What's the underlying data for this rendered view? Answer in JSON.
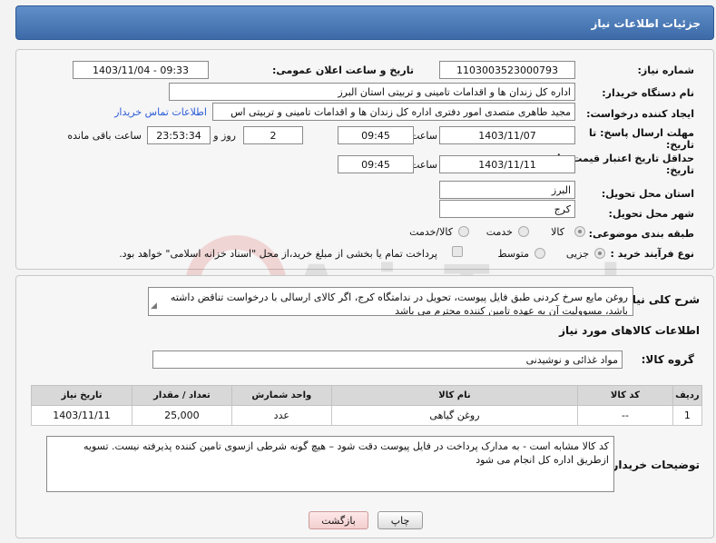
{
  "header": {
    "title": "جزئیات اطلاعات نیاز"
  },
  "form": {
    "need_number_label": "شماره نیاز:",
    "need_number": "1103003523000793",
    "announce_label": "تاریخ و ساعت اعلان عمومی:",
    "announce_value": "1403/11/04 - 09:33",
    "buyer_org_label": "نام دستگاه خریدار:",
    "buyer_org": "اداره کل زندان ها و اقدامات تامینی و تربیتی استان البرز",
    "requester_label": "ایجاد کننده درخواست:",
    "requester": "مجید طاهری متصدی امور دفتری اداره کل زندان ها و اقدامات تامینی و تربیتی اس",
    "contact_link": "اطلاعات تماس خریدار",
    "reply_deadline_label": "مهلت ارسال پاسخ: تا",
    "date_word": "تاریخ:",
    "reply_date": "1403/11/07",
    "time_label": "ساعت",
    "reply_time": "09:45",
    "days_count": "2",
    "days_label": "روز و",
    "remaining_time": "23:53:34",
    "remaining_label": "ساعت باقی مانده",
    "price_validity_label": "حداقل تاریخ اعتبار قیمت: تا",
    "price_date": "1403/11/11",
    "price_time": "09:45",
    "province_label": "استان محل تحویل:",
    "province": "البرز",
    "city_label": "شهر محل تحویل:",
    "city": "کرج",
    "category_label": "طبقه بندی موضوعی:",
    "category_options": [
      "کالا",
      "خدمت",
      "کالا/خدمت"
    ],
    "process_label": "نوع فرآیند خرید :",
    "process_options": [
      "جزیی",
      "متوسط"
    ],
    "payment_note": "پرداخت تمام یا بخشی از مبلغ خرید،از محل \"اسناد خزانه اسلامی\" خواهد بود."
  },
  "description": {
    "label": "شرح کلی نیاز:",
    "text": "روغن مایع سرخ کردنی طبق فایل پیوست، تحویل در ندامتگاه کرج، اگر کالای ارسالی با درخواست تناقض داشته باشد، مسوولیت آن به عهده تامین کننده محترم می باشد"
  },
  "goods": {
    "section_title": "اطلاعات کالاهای مورد نیاز",
    "group_label": "گروه کالا:",
    "group_value": "مواد غذائی و نوشیدنی",
    "columns": [
      "ردیف",
      "کد کالا",
      "نام کالا",
      "واحد شمارش",
      "تعداد / مقدار",
      "تاریخ نیاز"
    ],
    "rows": [
      {
        "row": "1",
        "code": "--",
        "name": "روغن گیاهی",
        "unit": "عدد",
        "qty": "25,000",
        "date": "1403/11/11"
      }
    ]
  },
  "buyer_notes": {
    "label": "توضیحات خریدار:",
    "text": "کد کالا مشابه است - به مدارک پرداخت در فایل پیوست دقت شود – هیچ گونه شرطی ازسوی تامین کننده پذیرفته نیست. تسویه ازطریق اداره کل انجام می شود"
  },
  "buttons": {
    "print": "چاپ",
    "back": "بازگشت"
  },
  "watermark_text": "AriaTender.net"
}
